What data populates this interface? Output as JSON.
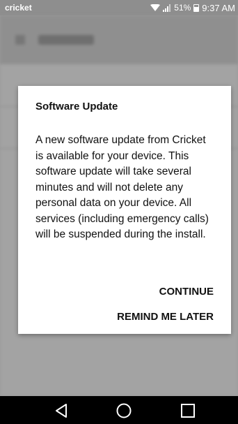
{
  "status_bar": {
    "carrier": "cricket",
    "battery": "51%",
    "time": "9:37 AM"
  },
  "dialog": {
    "title": "Software Update",
    "message": "A new software update from Cricket is available for your device. This software update will take several minutes and will not delete any personal data on your device. All services (including emergency calls) will be suspended during the install.",
    "buttons": {
      "continue": "CONTINUE",
      "remind_later": "REMIND ME LATER"
    }
  },
  "nav_bar": {
    "icons": [
      "back-icon",
      "home-icon",
      "recent-apps-icon"
    ]
  },
  "colors": {
    "dialog_bg": "#ffffff",
    "scrim": "#9a9a9a",
    "nav_bar": "#000000"
  }
}
